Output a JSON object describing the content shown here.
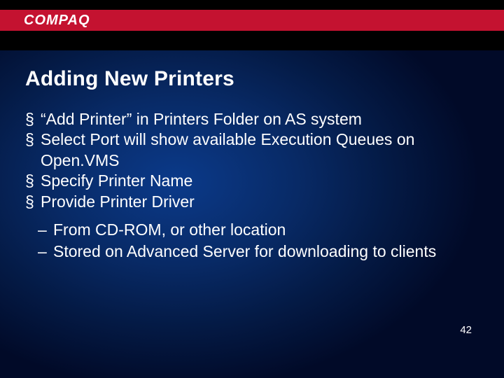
{
  "brand": "COMPAQ",
  "title": "Adding New Printers",
  "bullets": [
    {
      "text": "“Add Printer” in Printers Folder on AS system"
    },
    {
      "text": "Select Port will show available Execution Queues on Open.VMS"
    },
    {
      "text": "Specify Printer Name"
    },
    {
      "text": "Provide Printer Driver"
    }
  ],
  "subbullets": [
    {
      "text": "From CD-ROM, or other location"
    },
    {
      "text": "Stored on Advanced Server for downloading to clients"
    }
  ],
  "page_number": "42"
}
